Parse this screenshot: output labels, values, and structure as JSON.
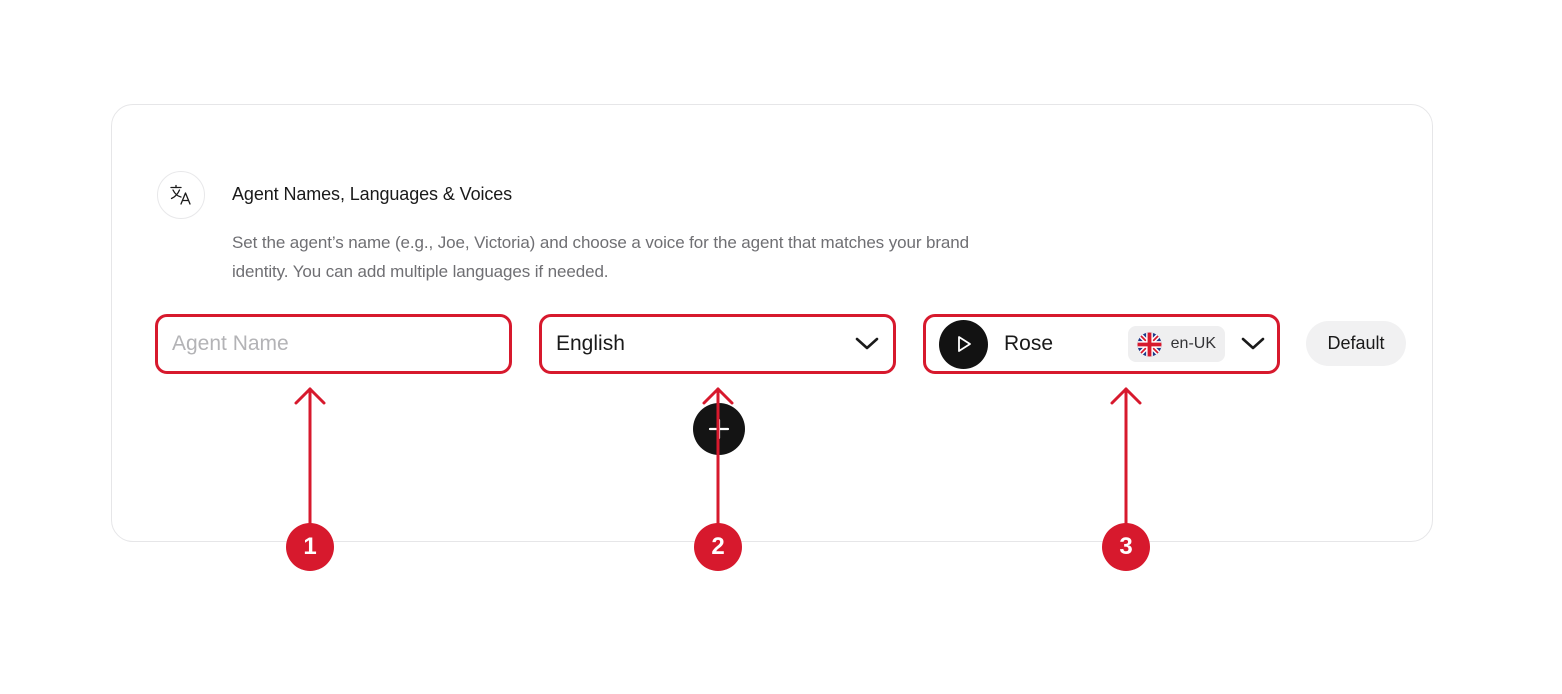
{
  "section": {
    "icon": "translate-icon",
    "title": "Agent Names, Languages & Voices",
    "description": "Set the agent’s name (e.g., Joe, Victoria) and choose a voice for the agent that matches your brand identity. You can add multiple languages if needed."
  },
  "agent_name": {
    "placeholder": "Agent Name",
    "value": ""
  },
  "language": {
    "selected": "English",
    "icon": "chevron-down-icon"
  },
  "voice": {
    "play_icon": "play-icon",
    "name": "Rose",
    "flag_icon": "uk-flag-icon",
    "locale": "en-UK",
    "dropdown_icon": "chevron-down-icon"
  },
  "default_button": {
    "label": "Default"
  },
  "add_button": {
    "icon": "plus-icon"
  },
  "callouts": [
    {
      "label": "1"
    },
    {
      "label": "2"
    },
    {
      "label": "3"
    }
  ],
  "colors": {
    "highlight": "#d7192d",
    "play_button": "#121212",
    "muted_text": "#6f6f73",
    "chip_background": "#efeff0"
  }
}
